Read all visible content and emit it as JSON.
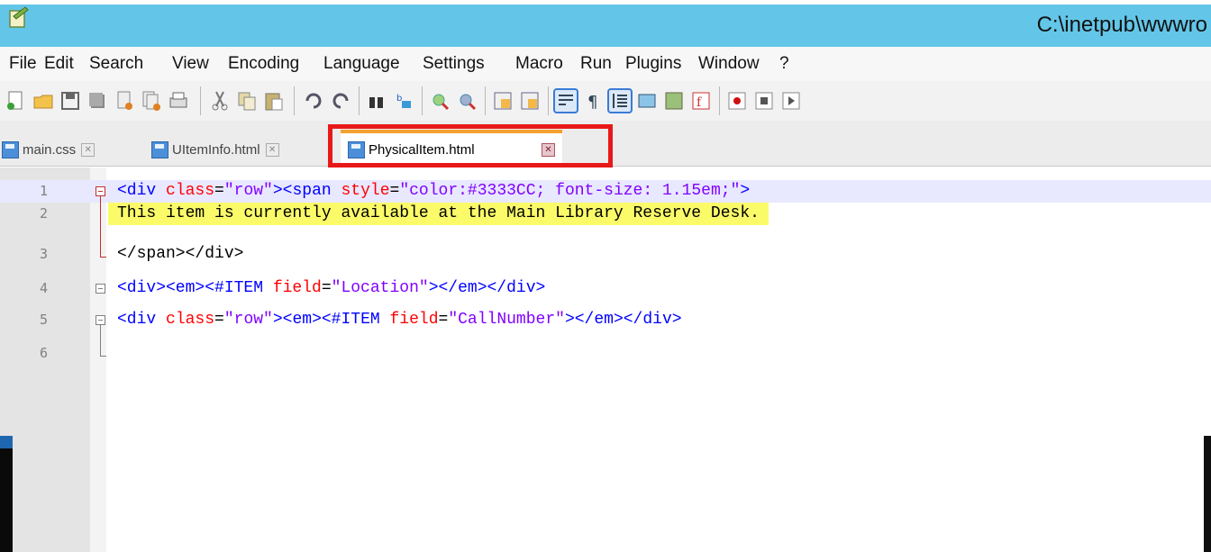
{
  "window": {
    "title": "C:\\inetpub\\wwwro"
  },
  "menu": [
    "File",
    "Edit",
    "Search",
    "View",
    "Encoding",
    "Language",
    "Settings",
    "Macro",
    "Run",
    "Plugins",
    "Window",
    "?"
  ],
  "tabs": [
    {
      "label": "main.css",
      "active": false
    },
    {
      "label": "UItemInfo.html",
      "active": false
    },
    {
      "label": "PhysicalItem.html",
      "active": true
    }
  ],
  "editor": {
    "line_numbers": [
      "1",
      "2",
      "3",
      "4",
      "5",
      "6"
    ],
    "lines": [
      {
        "parts": [
          "<div ",
          "class",
          "=",
          "\"row\"",
          "><span ",
          "style",
          "=",
          "\"color:#3333CC; font-size: 1.15em;\"",
          ">"
        ]
      },
      {
        "text": "This item is currently available at the Main Library Reserve Desk."
      },
      {
        "text": "</span></div>"
      },
      {
        "parts": [
          "<div><em><#ITEM ",
          "field",
          "=",
          "\"Location\"",
          "></em></div>"
        ]
      },
      {
        "parts": [
          "<div ",
          "class",
          "=",
          "\"row\"",
          "><em><#ITEM ",
          "field",
          "=",
          "\"CallNumber\"",
          "></em></div>"
        ]
      },
      {
        "text": ""
      }
    ]
  },
  "colors": {
    "tag": "#0000ff",
    "attr": "#ff0000",
    "string": "#8000ff",
    "highlight": "#fbfb6a",
    "current_line": "#e8e8ff",
    "callout": "#e81818"
  }
}
